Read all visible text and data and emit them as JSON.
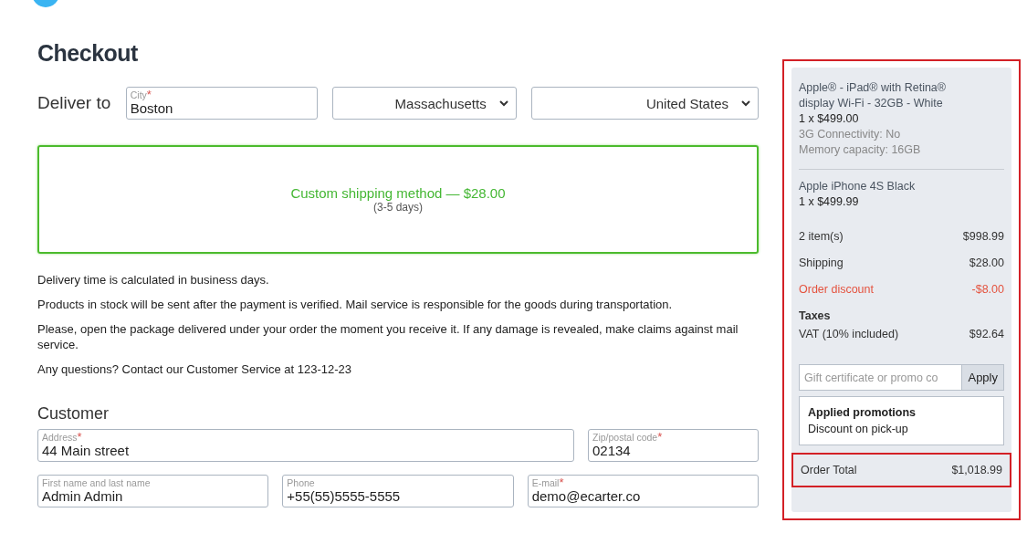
{
  "page_title": "Checkout",
  "deliver": {
    "label": "Deliver to",
    "city": {
      "label": "City",
      "required_mark": "*",
      "value": "Boston"
    },
    "state": "Massachusetts",
    "country": "United States"
  },
  "shipping_method": {
    "name": "Custom shipping method — $28.00",
    "time": "(3-5 days)",
    "selected": true
  },
  "notes": [
    "Delivery time is calculated in business days.",
    "Products in stock will be sent after the payment is verified. Mail service is responsible for the goods during transportation.",
    "Please, open the package delivered under your order the moment you receive it. If any damage is revealed, make claims against mail service.",
    "Any questions? Contact our Customer Service at 123-12-23"
  ],
  "customer": {
    "title": "Customer",
    "address_line": {
      "address": {
        "label": "Address",
        "required_mark": "*",
        "value": "44 Main street"
      },
      "zip": {
        "label": "Zip/postal code",
        "required_mark": "*",
        "value": "02134"
      }
    },
    "contact_line": [
      {
        "label": "First name and last name",
        "value": "Admin Admin"
      },
      {
        "label": "Phone",
        "value": "+55(55)5555-5555"
      },
      {
        "label": "E-mail",
        "required_mark": "*",
        "value": "demo@ecarter.co"
      }
    ]
  },
  "summary": {
    "highlighted": true,
    "products": [
      {
        "name": "Apple® - iPad® with Retina® display Wi-Fi - 32GB - White",
        "price": "1 x $499.00",
        "options": [
          "3G Connectivity: No",
          "Memory capacity: 16GB"
        ]
      },
      {
        "name": "Apple iPhone 4S Black",
        "price": "1 x $499.99"
      }
    ],
    "lines": [
      {
        "label": "2 item(s)",
        "value": "$998.99",
        "kind": "normal"
      },
      {
        "label": "Shipping",
        "value": "$28.00",
        "kind": "normal"
      },
      {
        "label": "Order discount",
        "value": "-$8.00",
        "kind": "discount"
      }
    ],
    "taxes": {
      "title": "Taxes",
      "label": "VAT (10% included)",
      "value": "$92.64"
    },
    "promo": {
      "placeholder": "Gift certificate or promo co",
      "button": "Apply"
    },
    "promotions": {
      "title": "Applied promotions",
      "items": [
        "Discount on pick-up"
      ]
    },
    "total": {
      "label": "Order Total",
      "value": "$1,018.99",
      "highlighted": true
    }
  }
}
